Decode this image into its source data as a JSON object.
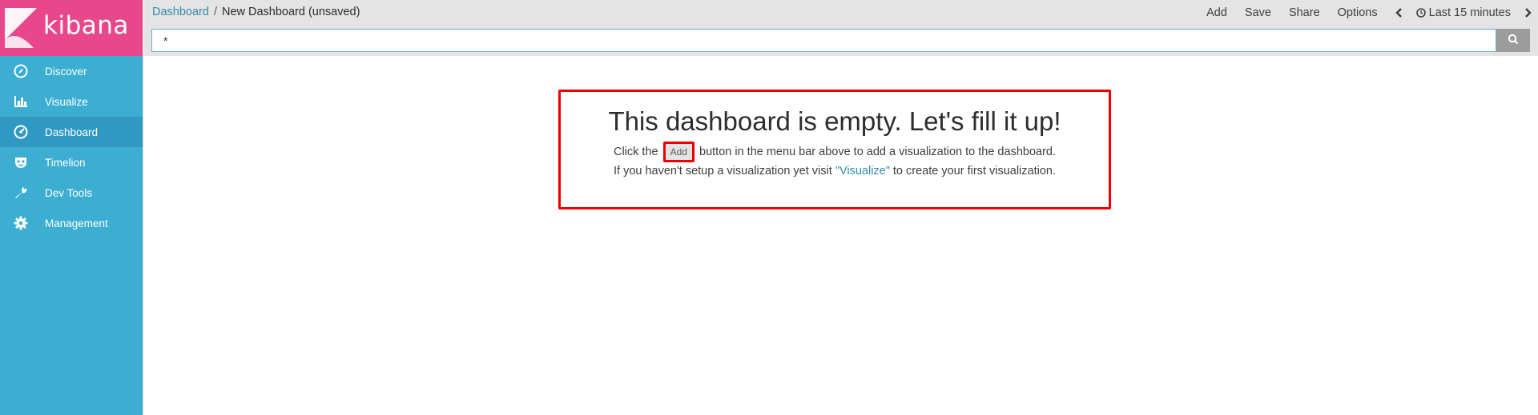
{
  "app": {
    "logo_text": "kibana",
    "brand_color": "#e8488b",
    "sidebar_color": "#3caed2"
  },
  "sidebar": {
    "items": [
      {
        "label": "Discover",
        "icon": "compass-icon",
        "active": false
      },
      {
        "label": "Visualize",
        "icon": "bar-chart-icon",
        "active": false
      },
      {
        "label": "Dashboard",
        "icon": "dashboard-gauge-icon",
        "active": true
      },
      {
        "label": "Timelion",
        "icon": "timelion-mask-icon",
        "active": false
      },
      {
        "label": "Dev Tools",
        "icon": "wrench-icon",
        "active": false
      },
      {
        "label": "Management",
        "icon": "gear-icon",
        "active": false
      }
    ]
  },
  "breadcrumb": {
    "parent": "Dashboard",
    "separator": "/",
    "current": "New Dashboard (unsaved)"
  },
  "menu": {
    "add": "Add",
    "save": "Save",
    "share": "Share",
    "options": "Options",
    "time_range": "Last 15 minutes"
  },
  "search": {
    "value": "*"
  },
  "empty_state": {
    "title": "This dashboard is empty. Let's fill it up!",
    "line1_before": "Click the",
    "add_button": "Add",
    "line1_after": "button in the menu bar above to add a visualization to the dashboard.",
    "line2_before": "If you haven't setup a visualization yet visit",
    "link": "\"Visualize\"",
    "line2_after": "to create your first visualization."
  }
}
